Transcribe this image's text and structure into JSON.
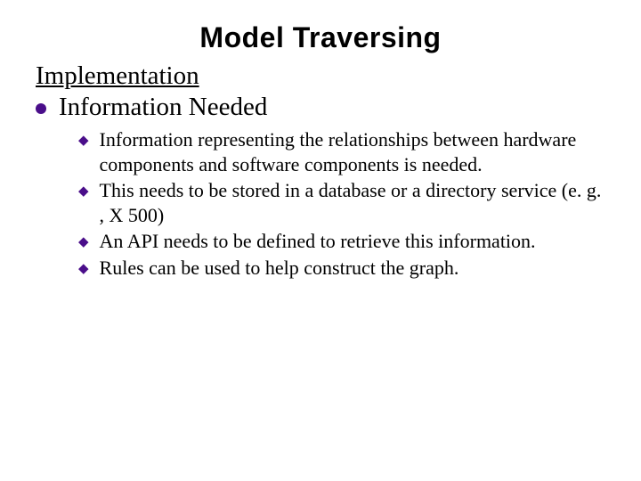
{
  "title": "Model Traversing",
  "subtitle": "Implementation",
  "level1": {
    "items": [
      {
        "text": "Information Needed"
      }
    ]
  },
  "level2": {
    "items": [
      {
        "text": "Information representing the relationships between hardware components and software components is needed."
      },
      {
        "text": "This needs to be stored in a database or a directory service (e. g. , X 500)"
      },
      {
        "text": "An API needs to be defined to retrieve this information."
      },
      {
        "text": "Rules can be used to help construct the graph."
      }
    ]
  }
}
